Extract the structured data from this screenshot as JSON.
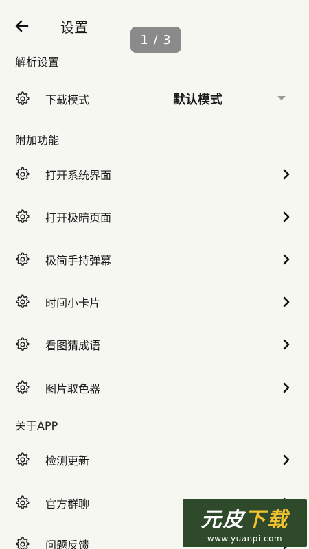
{
  "header": {
    "title": "设置",
    "page_indicator": "1 / 3",
    "back_icon": "arrow-left-icon"
  },
  "sections": [
    {
      "title": "解析设置"
    },
    {
      "title": "附加功能"
    },
    {
      "title": "关于APP"
    }
  ],
  "parse_settings": {
    "download_mode": {
      "label": "下载模式",
      "value": "默认模式"
    }
  },
  "extra_features": [
    {
      "label": "打开系统界面"
    },
    {
      "label": "打开极暗页面"
    },
    {
      "label": "极简手持弹幕"
    },
    {
      "label": "时间小卡片"
    },
    {
      "label": "看图猜成语"
    },
    {
      "label": "图片取色器"
    }
  ],
  "about_app": [
    {
      "label": "检测更新"
    },
    {
      "label": "官方群聊"
    },
    {
      "label": "问题反馈"
    }
  ],
  "watermark": {
    "main_a": "元皮",
    "main_b": "下载",
    "url": "www.yuanpi.com"
  },
  "colors": {
    "background": "#f7f7f2",
    "indicator": "#8a8a8a",
    "watermark_bg": "#2f4a2a",
    "watermark_accent": "#f2c230"
  }
}
